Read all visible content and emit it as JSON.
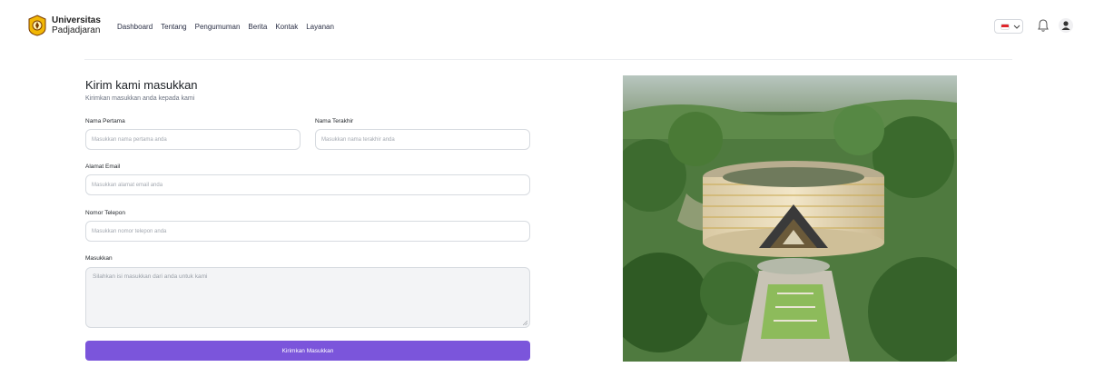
{
  "header": {
    "brand_line1": "Universitas",
    "brand_line2": "Padjadjaran",
    "nav": [
      "Dashboard",
      "Tentang",
      "Pengumuman",
      "Berita",
      "Kontak",
      "Layanan"
    ],
    "language_flag": "indonesia-flag-icon",
    "icons": [
      "chevron-down-icon",
      "bell-icon",
      "user-icon"
    ]
  },
  "form": {
    "title": "Kirim kami masukkan",
    "subtitle": "Kirimkan masukkan anda kepada kami",
    "first_name": {
      "label": "Nama Pertama",
      "placeholder": "Masukkan nama pertama anda"
    },
    "last_name": {
      "label": "Nama Terakhir",
      "placeholder": "Masukkan nama terakhir anda"
    },
    "email": {
      "label": "Alamat Email",
      "placeholder": "Masukkan alamat email anda"
    },
    "phone": {
      "label": "Nomor Telepon",
      "placeholder": "Masukkan nomor telepon anda"
    },
    "feedback": {
      "label": "Masukkan",
      "placeholder": "Silahkan isi masukkan dari anda untuk kami"
    },
    "submit_label": "Kirimkan Masukkan"
  },
  "colors": {
    "accent": "#7b55db",
    "border": "#d7dbe0",
    "flag_red": "#e0252a"
  },
  "image": {
    "subject": "aerial-campus-building-photo"
  }
}
